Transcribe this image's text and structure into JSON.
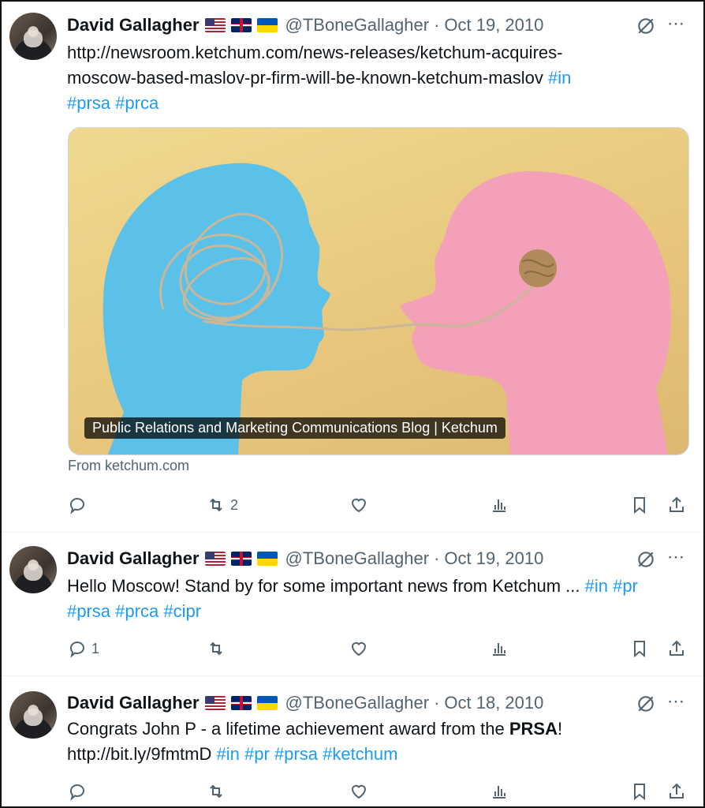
{
  "tweets": [
    {
      "name": "David Gallagher",
      "handle": "@TBoneGallagher",
      "date": "Oct 19, 2010",
      "text_plain_1": "http://newsroom.ketchum.com/news-releases/ketchum-acquires-",
      "text_plain_2": "moscow-based-maslov-pr-firm-will-be-known-ketchum-maslov ",
      "tag_in": "#in",
      "tag_prsa": "#prsa",
      "tag_prca": "#prca",
      "card_label": "Public Relations and Marketing Communications Blog | Ketchum",
      "card_from": "From ketchum.com",
      "retweets": "2"
    },
    {
      "name": "David Gallagher",
      "handle": "@TBoneGallagher",
      "date": "Oct 19, 2010",
      "text_plain_1": "Hello Moscow!  Stand by for some important news from Ketchum ... ",
      "tag_in": "#in",
      "tag_pr": "#pr",
      "tag_prsa": "#prsa",
      "tag_prca": "#prca",
      "tag_cipr": "#cipr",
      "replies": "1"
    },
    {
      "name": "David Gallagher",
      "handle": "@TBoneGallagher",
      "date": "Oct 18, 2010",
      "text_plain_1": "Congrats John P - a lifetime achievement award from the ",
      "text_bold": "PRSA",
      "text_plain_2": "!",
      "link": "http://bit.ly/9fmtmD",
      "tag_in": "#in",
      "tag_pr": "#pr",
      "tag_prsa": "#prsa",
      "tag_ketchum": "#ketchum"
    }
  ],
  "icons": {
    "reply": "reply-icon",
    "retweet": "retweet-icon",
    "like": "heart-icon",
    "views": "views-icon",
    "bookmark": "bookmark-icon",
    "share": "share-icon",
    "grok": "grok-icon",
    "more": "more-icon"
  },
  "colors": {
    "link": "#1d9bf0",
    "muted": "#536471",
    "text": "#0f1419"
  },
  "more_glyph": "⋯",
  "separator": "·"
}
